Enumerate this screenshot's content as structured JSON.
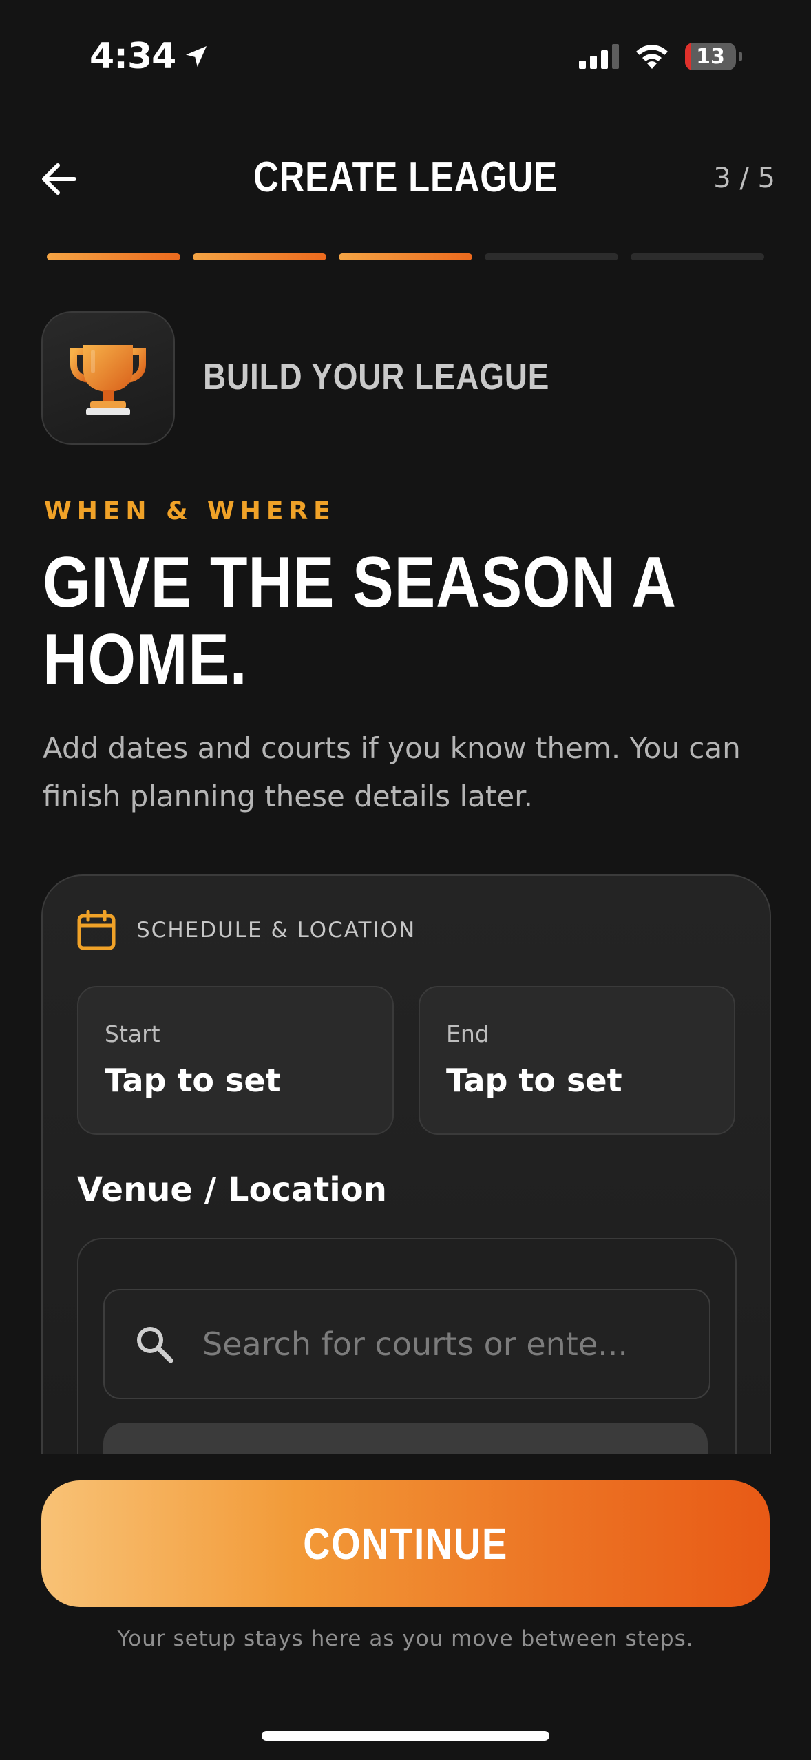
{
  "status_bar": {
    "time": "4:34",
    "battery": "13"
  },
  "header": {
    "title": "CREATE LEAGUE",
    "step": "3 / 5",
    "progress": {
      "completed": 3,
      "total": 5
    }
  },
  "section": {
    "badge_icon": "trophy-icon",
    "label": "BUILD YOUR LEAGUE"
  },
  "intro": {
    "eyebrow": "WHEN & WHERE",
    "headline": "GIVE THE SEASON A HOME.",
    "subtext": "Add dates and courts if you know them. You can finish planning these details later."
  },
  "card": {
    "icon": "calendar-icon",
    "title": "SCHEDULE & LOCATION",
    "start": {
      "label": "Start",
      "value": "Tap to set"
    },
    "end": {
      "label": "End",
      "value": "Tap to set"
    },
    "venue_label": "Venue / Location",
    "search_placeholder": "Search for courts or ente..."
  },
  "footer": {
    "continue_label": "CONTINUE",
    "note": "Your setup stays here as you move between steps."
  },
  "colors": {
    "accent": "#f0a228",
    "gradient_start": "#f8c276",
    "gradient_end": "#e85a16",
    "background": "#141414"
  }
}
